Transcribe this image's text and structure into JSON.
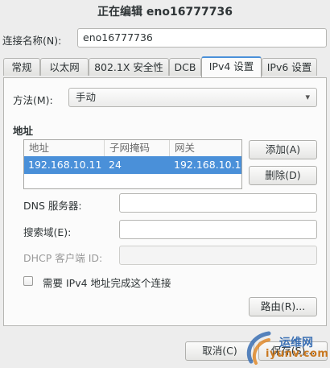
{
  "window": {
    "title": "正在编辑 eno16777736"
  },
  "connection": {
    "name_label": "连接名称(N):",
    "name_value": "eno16777736"
  },
  "tabs": [
    {
      "label": "常规"
    },
    {
      "label": "以太网"
    },
    {
      "label": "802.1X 安全性"
    },
    {
      "label": "DCB"
    },
    {
      "label": "IPv4 设置",
      "active": true
    },
    {
      "label": "IPv6 设置"
    }
  ],
  "ipv4": {
    "method_label": "方法(M):",
    "method_value": "手动",
    "addresses_heading": "地址",
    "columns": [
      "地址",
      "子网掩码",
      "网关"
    ],
    "rows": [
      {
        "address": "192.168.10.11",
        "netmask": "24",
        "gateway": "192.168.10.1"
      }
    ],
    "add_label": "添加(A)",
    "delete_label": "删除(D)",
    "dns_label": "DNS 服务器:",
    "dns_value": "",
    "search_label": "搜索域(E):",
    "search_value": "",
    "dhcp_label": "DHCP 客户端 ID:",
    "dhcp_value": "",
    "require_label": "需要 IPv4 地址完成这个连接",
    "require_checked": false,
    "routes_label": "路由(R)..."
  },
  "footer": {
    "cancel_label": "取消(C)",
    "save_label": "保存(S)..."
  },
  "watermark": {
    "line1": "运维网",
    "line2": "iyunv.com"
  },
  "colors": {
    "accent": "#4a90d9",
    "background": "#ededed"
  }
}
